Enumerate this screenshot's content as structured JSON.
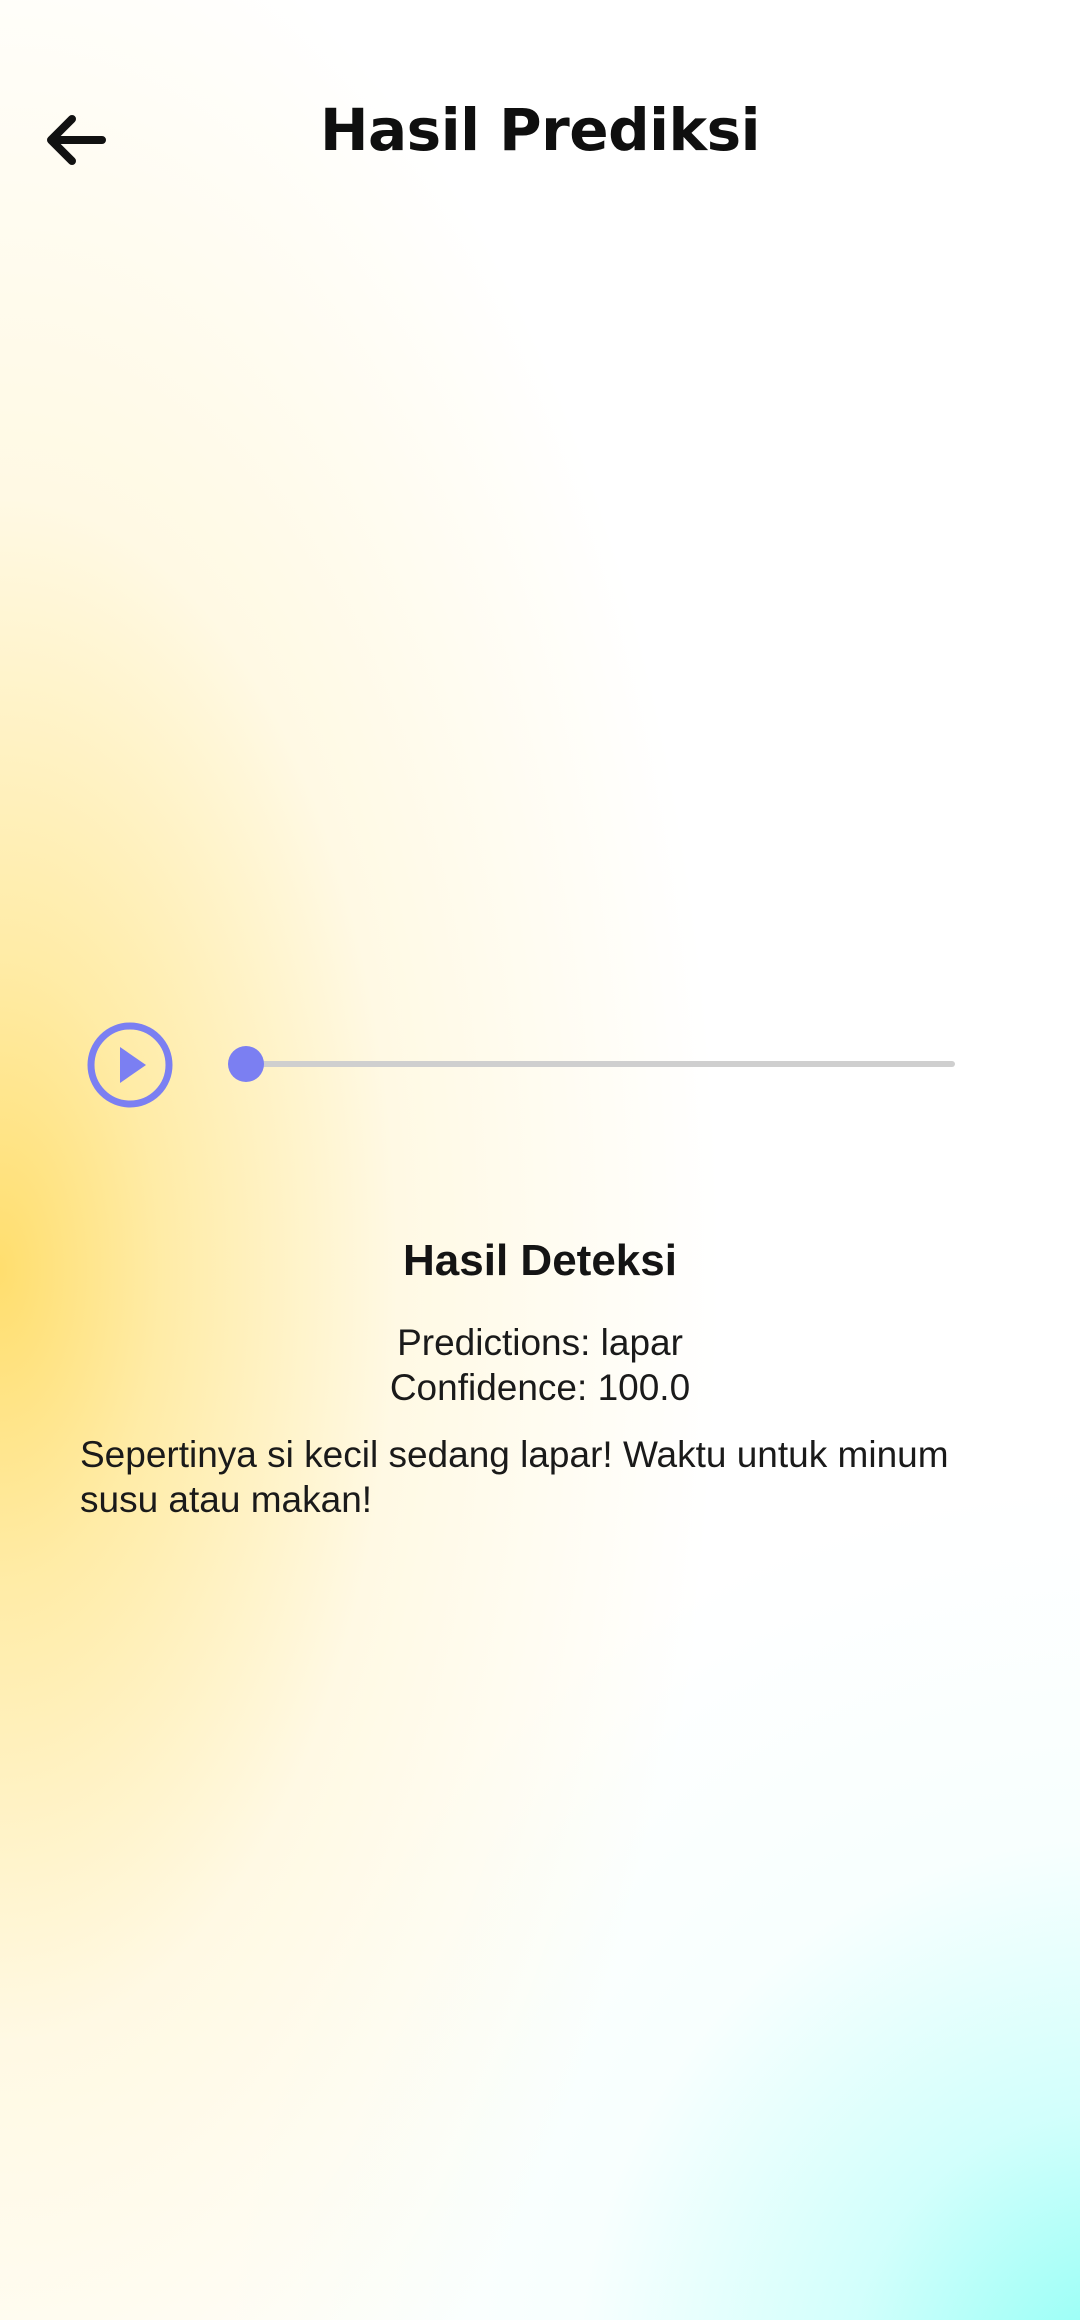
{
  "header": {
    "title": "Hasil Prediksi",
    "back_icon": "arrow-left-icon"
  },
  "player": {
    "play_icon": "play-circle-icon",
    "progress": 0,
    "accent_color": "#7b7ff2"
  },
  "result": {
    "title": "Hasil Deteksi",
    "predictions": "Predictions: lapar",
    "confidence": "Confidence: 100.0",
    "message": "Sepertinya si kecil sedang lapar! Waktu untuk minum susu atau makan!"
  }
}
